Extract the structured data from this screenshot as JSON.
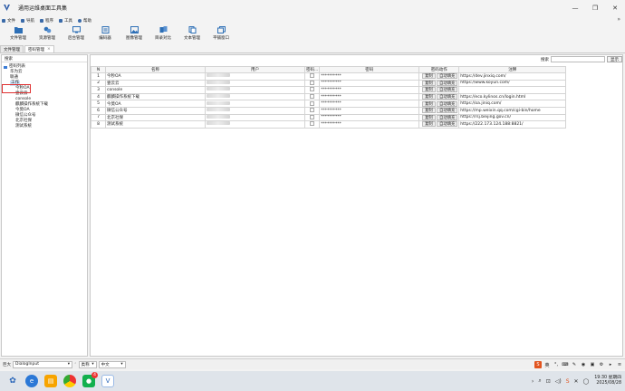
{
  "window": {
    "title": "通用运维桌面工具集"
  },
  "menu": [
    {
      "label": "文件"
    },
    {
      "label": "导航"
    },
    {
      "label": "程序"
    },
    {
      "label": "工具"
    },
    {
      "label": "帮助"
    }
  ],
  "toolbar": [
    {
      "label": "文件管理",
      "icon": "folder-icon"
    },
    {
      "label": "资源管理",
      "icon": "resource-icon"
    },
    {
      "label": "后台管理",
      "icon": "monitor-icon"
    },
    {
      "label": "编码器",
      "icon": "encoder-icon"
    },
    {
      "label": "图像管理",
      "icon": "image-icon"
    },
    {
      "label": "目录对比",
      "icon": "compare-icon"
    },
    {
      "label": "文本管理",
      "icon": "text-icon"
    },
    {
      "label": "平铺窗口",
      "icon": "tile-icon"
    }
  ],
  "tabs": [
    {
      "label": "文件管理"
    },
    {
      "label": "密码管理",
      "close": "×"
    }
  ],
  "left": {
    "search_label": "搜索",
    "tree": {
      "root": "密码列表",
      "groups": [
        "华为云",
        "联通",
        "工作"
      ],
      "selected_group": "工作",
      "items": [
        "今秒OA",
        "壹云云",
        "console",
        "麒麟操作系统下载",
        "今莫OA",
        "微信公众号",
        "北京社保",
        "测试系统"
      ]
    }
  },
  "right": {
    "search_label": "搜索",
    "show_button": "显示",
    "columns": [
      "N",
      "名称",
      "用户",
      "密码...",
      "密码",
      "密码动作",
      "注释"
    ],
    "copy_label": "复制",
    "autofill_label": "自动填充",
    "masked": "**********",
    "rows": [
      {
        "n": "1",
        "name": "今秒OA",
        "note": "https://dev.jinxiq.com/"
      },
      {
        "n": "2",
        "name": "壹云云",
        "note": "https://www.koyun.com/"
      },
      {
        "n": "3",
        "name": "console",
        "note": ""
      },
      {
        "n": "4",
        "name": "麒麟操作系统下载",
        "note": "https://eco.kylinos.cn/login.html"
      },
      {
        "n": "5",
        "name": "今莫OA",
        "note": "https://oa.jiniq.com/"
      },
      {
        "n": "6",
        "name": "微信公众号",
        "note": "https://mp.weixin.qq.com/cgi-bin/home"
      },
      {
        "n": "7",
        "name": "北京社保",
        "note": "https://rsj.beijing.gov.cn/"
      },
      {
        "n": "8",
        "name": "测试系统",
        "note": "https://222.173.124.188:8821/"
      }
    ]
  },
  "statusbar": {
    "size_label": "巨大",
    "dialog_value": "DialogInput",
    "mode_value": "类称",
    "lang_value": "中文"
  },
  "taskbar": {
    "time": "19:30 星期四",
    "date": "2025/08/28",
    "badge": "4"
  }
}
